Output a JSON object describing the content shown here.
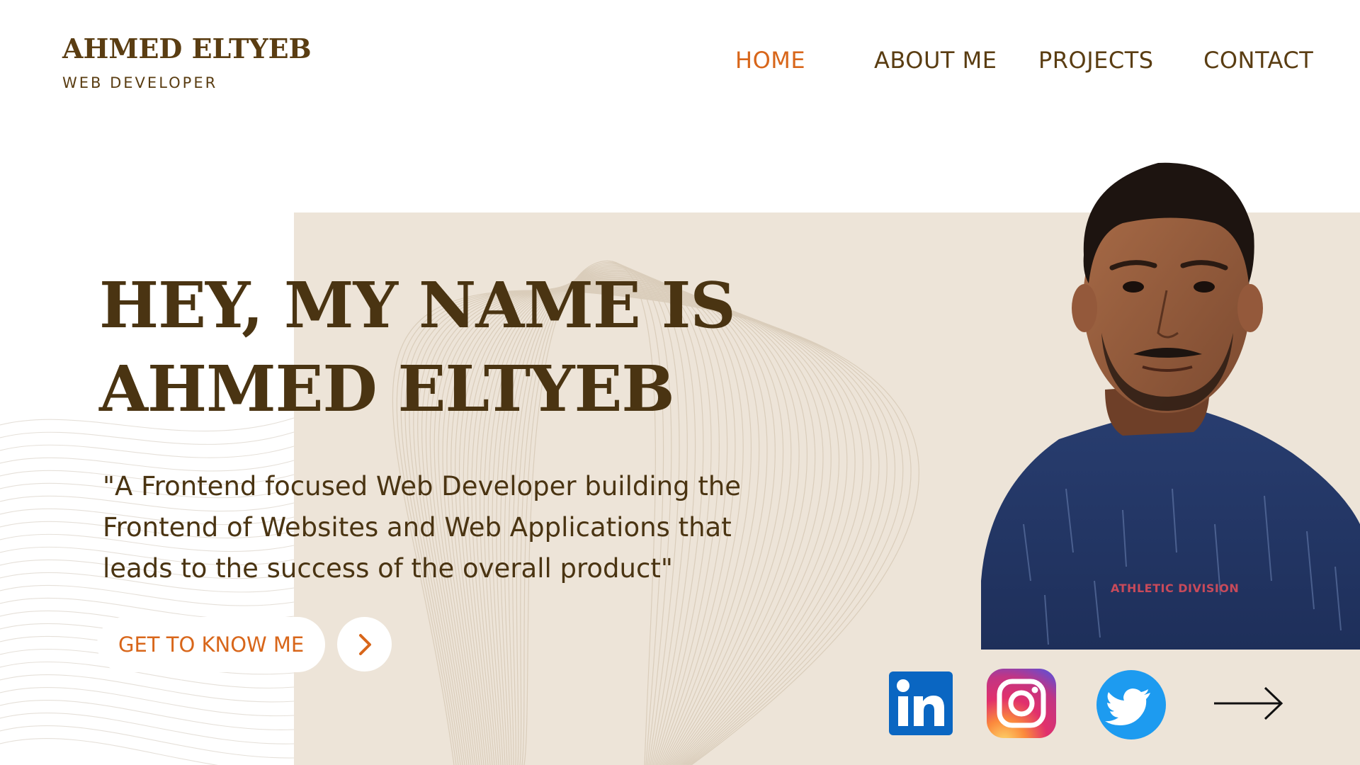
{
  "brand": {
    "name": "AHMED ELTYEB",
    "role": "WEB DEVELOPER"
  },
  "nav": {
    "items": [
      {
        "label": "HOME",
        "active": true
      },
      {
        "label": "ABOUT ME",
        "active": false
      },
      {
        "label": "PROJECTS",
        "active": false
      },
      {
        "label": "CONTACT",
        "active": false
      }
    ]
  },
  "hero": {
    "headline_line1": "HEY, MY NAME IS",
    "headline_line2": "AHMED ELTYEB",
    "tagline": "\"A Frontend focused Web Developer building the Frontend of Websites and Web Applications that leads to the success of the overall product\"",
    "cta_label": "GET TO KNOW ME"
  },
  "photo": {
    "shirt_text": "ATHLETIC DIVISION"
  },
  "social": {
    "icons": [
      "linkedin-icon",
      "instagram-icon",
      "twitter-icon",
      "arrow-right-icon"
    ]
  },
  "colors": {
    "accent": "#d8661a",
    "brown": "#5a3d12",
    "heading": "#4a3412",
    "panel": "#ede4d8",
    "linkedin": "#0a66c2",
    "twitter": "#1d9bf0"
  }
}
